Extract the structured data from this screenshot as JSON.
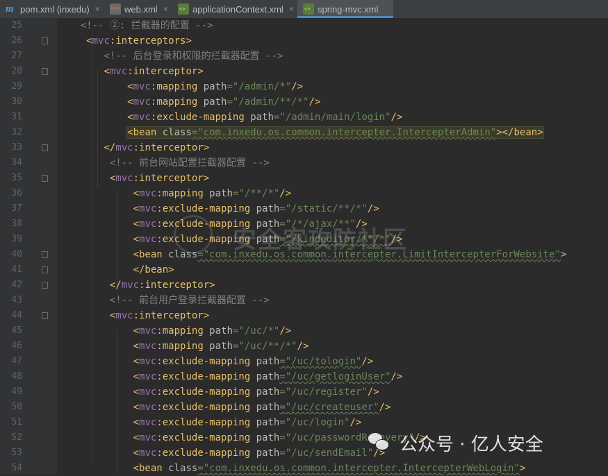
{
  "tabs": [
    {
      "label": "pom.xml (inxedu)",
      "icon": "maven-icon",
      "close": "×",
      "active": false
    },
    {
      "label": "web.xml",
      "icon": "xml-file-icon",
      "close": "×",
      "active": false
    },
    {
      "label": "applicationContext.xml",
      "icon": "spring-xml-icon",
      "close": "×",
      "active": false
    },
    {
      "label": "spring-mvc.xml",
      "icon": "spring-xml-icon",
      "close": "×",
      "active": true
    }
  ],
  "lines": [
    {
      "n": "25",
      "indent": "    ",
      "fold": false,
      "tokens": [
        {
          "k": "c",
          "t": "<!-- ②: 拦截器的配置 -->"
        }
      ]
    },
    {
      "n": "26",
      "indent": "     ",
      "fold": true,
      "tokens": [
        {
          "k": "t",
          "t": "<"
        },
        {
          "k": "ns",
          "t": "mvc"
        },
        {
          "k": "t",
          "t": ":interceptors>"
        }
      ]
    },
    {
      "n": "27",
      "indent": "        ",
      "fold": false,
      "tokens": [
        {
          "k": "c",
          "t": "<!-- 后台登录和权限的拦截器配置 -->"
        }
      ]
    },
    {
      "n": "28",
      "indent": "        ",
      "fold": true,
      "tokens": [
        {
          "k": "t",
          "t": "<"
        },
        {
          "k": "ns",
          "t": "mvc"
        },
        {
          "k": "t",
          "t": ":interceptor>"
        }
      ]
    },
    {
      "n": "29",
      "indent": "            ",
      "fold": false,
      "tokens": [
        {
          "k": "t",
          "t": "<"
        },
        {
          "k": "ns",
          "t": "mvc"
        },
        {
          "k": "t",
          "t": ":mapping "
        },
        {
          "k": "a",
          "t": "path"
        },
        {
          "k": "v",
          "t": "=\"/admin/*\""
        },
        {
          "k": "t",
          "t": "/>"
        }
      ]
    },
    {
      "n": "30",
      "indent": "            ",
      "fold": false,
      "tokens": [
        {
          "k": "t",
          "t": "<"
        },
        {
          "k": "ns",
          "t": "mvc"
        },
        {
          "k": "t",
          "t": ":mapping "
        },
        {
          "k": "a",
          "t": "path"
        },
        {
          "k": "v",
          "t": "=\"/admin/**/*\""
        },
        {
          "k": "t",
          "t": "/>"
        }
      ]
    },
    {
      "n": "31",
      "indent": "            ",
      "fold": false,
      "tokens": [
        {
          "k": "t",
          "t": "<"
        },
        {
          "k": "ns",
          "t": "mvc"
        },
        {
          "k": "t",
          "t": ":exclude-mapping "
        },
        {
          "k": "a",
          "t": "path"
        },
        {
          "k": "v",
          "t": "=\"/admin/main/login\""
        },
        {
          "k": "t",
          "t": "/>"
        }
      ]
    },
    {
      "n": "32",
      "indent": "            ",
      "fold": false,
      "hl": true,
      "tokens": [
        {
          "k": "t",
          "t": "<bean "
        },
        {
          "k": "a",
          "t": "class"
        },
        {
          "k": "v",
          "t": "=\"com.inxedu.os.common.intercepter.IntercepterAdmin\""
        },
        {
          "k": "t",
          "t": "></bean>"
        }
      ]
    },
    {
      "n": "33",
      "indent": "        ",
      "fold": true,
      "tokens": [
        {
          "k": "t",
          "t": "</"
        },
        {
          "k": "ns",
          "t": "mvc"
        },
        {
          "k": "t",
          "t": ":interceptor>"
        }
      ]
    },
    {
      "n": "34",
      "indent": "         ",
      "fold": false,
      "tokens": [
        {
          "k": "c",
          "t": "<!-- 前台网站配置拦截器配置 -->"
        }
      ]
    },
    {
      "n": "35",
      "indent": "         ",
      "fold": true,
      "tokens": [
        {
          "k": "t",
          "t": "<"
        },
        {
          "k": "ns",
          "t": "mvc"
        },
        {
          "k": "t",
          "t": ":interceptor>"
        }
      ]
    },
    {
      "n": "36",
      "indent": "             ",
      "fold": false,
      "tokens": [
        {
          "k": "t",
          "t": "<"
        },
        {
          "k": "ns",
          "t": "mvc"
        },
        {
          "k": "t",
          "t": ":mapping "
        },
        {
          "k": "a",
          "t": "path"
        },
        {
          "k": "v",
          "t": "=\"/**/*\""
        },
        {
          "k": "t",
          "t": "/>"
        }
      ]
    },
    {
      "n": "37",
      "indent": "             ",
      "fold": false,
      "tokens": [
        {
          "k": "t",
          "t": "<"
        },
        {
          "k": "ns",
          "t": "mvc"
        },
        {
          "k": "t",
          "t": ":exclude-mapping "
        },
        {
          "k": "a",
          "t": "path"
        },
        {
          "k": "v",
          "t": "=\"/static/**/*\""
        },
        {
          "k": "t",
          "t": "/>"
        }
      ]
    },
    {
      "n": "38",
      "indent": "             ",
      "fold": false,
      "tokens": [
        {
          "k": "t",
          "t": "<"
        },
        {
          "k": "ns",
          "t": "mvc"
        },
        {
          "k": "t",
          "t": ":exclude-mapping "
        },
        {
          "k": "a",
          "t": "path"
        },
        {
          "k": "v",
          "t": "=\"/*/ajax/**\""
        },
        {
          "k": "t",
          "t": "/>"
        }
      ]
    },
    {
      "n": "39",
      "indent": "             ",
      "fold": false,
      "tokens": [
        {
          "k": "t",
          "t": "<"
        },
        {
          "k": "ns",
          "t": "mvc"
        },
        {
          "k": "t",
          "t": ":exclude-mapping "
        },
        {
          "k": "a",
          "t": "path"
        },
        {
          "k": "v",
          "t": "=\"/kindeditor/**/*\""
        },
        {
          "k": "t",
          "t": "/>"
        }
      ]
    },
    {
      "n": "40",
      "indent": "             ",
      "fold": true,
      "tokens": [
        {
          "k": "t",
          "t": "<bean "
        },
        {
          "k": "a",
          "t": "class"
        },
        {
          "k": "v",
          "t": "=\"com.inxedu.os.common.intercepter.LimitIntercepterForWebsite\""
        },
        {
          "k": "t",
          "t": ">"
        }
      ]
    },
    {
      "n": "41",
      "indent": "             ",
      "fold": true,
      "tokens": [
        {
          "k": "t",
          "t": "</bean>"
        }
      ]
    },
    {
      "n": "42",
      "indent": "         ",
      "fold": true,
      "tokens": [
        {
          "k": "t",
          "t": "</"
        },
        {
          "k": "ns",
          "t": "mvc"
        },
        {
          "k": "t",
          "t": ":interceptor>"
        }
      ]
    },
    {
      "n": "43",
      "indent": "         ",
      "fold": false,
      "tokens": [
        {
          "k": "c",
          "t": "<!-- 前台用户登录拦截器配置 -->"
        }
      ]
    },
    {
      "n": "44",
      "indent": "         ",
      "fold": true,
      "tokens": [
        {
          "k": "t",
          "t": "<"
        },
        {
          "k": "ns",
          "t": "mvc"
        },
        {
          "k": "t",
          "t": ":interceptor>"
        }
      ]
    },
    {
      "n": "45",
      "indent": "             ",
      "fold": false,
      "tokens": [
        {
          "k": "t",
          "t": "<"
        },
        {
          "k": "ns",
          "t": "mvc"
        },
        {
          "k": "t",
          "t": ":mapping "
        },
        {
          "k": "a",
          "t": "path"
        },
        {
          "k": "v",
          "t": "=\"/uc/*\""
        },
        {
          "k": "t",
          "t": "/>"
        }
      ]
    },
    {
      "n": "46",
      "indent": "             ",
      "fold": false,
      "tokens": [
        {
          "k": "t",
          "t": "<"
        },
        {
          "k": "ns",
          "t": "mvc"
        },
        {
          "k": "t",
          "t": ":mapping "
        },
        {
          "k": "a",
          "t": "path"
        },
        {
          "k": "v",
          "t": "=\"/uc/**/*\""
        },
        {
          "k": "t",
          "t": "/>"
        }
      ]
    },
    {
      "n": "47",
      "indent": "             ",
      "fold": false,
      "tokens": [
        {
          "k": "t",
          "t": "<"
        },
        {
          "k": "ns",
          "t": "mvc"
        },
        {
          "k": "t",
          "t": ":exclude-mapping "
        },
        {
          "k": "a",
          "t": "path"
        },
        {
          "k": "v",
          "t": "=\"/uc/tologin\""
        },
        {
          "k": "t",
          "t": "/>"
        }
      ]
    },
    {
      "n": "48",
      "indent": "             ",
      "fold": false,
      "tokens": [
        {
          "k": "t",
          "t": "<"
        },
        {
          "k": "ns",
          "t": "mvc"
        },
        {
          "k": "t",
          "t": ":exclude-mapping "
        },
        {
          "k": "a",
          "t": "path"
        },
        {
          "k": "v",
          "t": "=\"/uc/getloginUser\""
        },
        {
          "k": "t",
          "t": "/>"
        }
      ]
    },
    {
      "n": "49",
      "indent": "             ",
      "fold": false,
      "tokens": [
        {
          "k": "t",
          "t": "<"
        },
        {
          "k": "ns",
          "t": "mvc"
        },
        {
          "k": "t",
          "t": ":exclude-mapping "
        },
        {
          "k": "a",
          "t": "path"
        },
        {
          "k": "v",
          "t": "=\"/uc/register\""
        },
        {
          "k": "t",
          "t": "/>"
        }
      ]
    },
    {
      "n": "50",
      "indent": "             ",
      "fold": false,
      "tokens": [
        {
          "k": "t",
          "t": "<"
        },
        {
          "k": "ns",
          "t": "mvc"
        },
        {
          "k": "t",
          "t": ":exclude-mapping "
        },
        {
          "k": "a",
          "t": "path"
        },
        {
          "k": "v",
          "t": "=\"/uc/createuser\""
        },
        {
          "k": "t",
          "t": "/>"
        }
      ]
    },
    {
      "n": "51",
      "indent": "             ",
      "fold": false,
      "tokens": [
        {
          "k": "t",
          "t": "<"
        },
        {
          "k": "ns",
          "t": "mvc"
        },
        {
          "k": "t",
          "t": ":exclude-mapping "
        },
        {
          "k": "a",
          "t": "path"
        },
        {
          "k": "v",
          "t": "=\"/uc/login\""
        },
        {
          "k": "t",
          "t": "/>"
        }
      ]
    },
    {
      "n": "52",
      "indent": "             ",
      "fold": false,
      "tokens": [
        {
          "k": "t",
          "t": "<"
        },
        {
          "k": "ns",
          "t": "mvc"
        },
        {
          "k": "t",
          "t": ":exclude-mapping "
        },
        {
          "k": "a",
          "t": "path"
        },
        {
          "k": "v",
          "t": "=\"/uc/passwordRecovery\""
        },
        {
          "k": "t",
          "t": "/>"
        }
      ]
    },
    {
      "n": "53",
      "indent": "             ",
      "fold": false,
      "tokens": [
        {
          "k": "t",
          "t": "<"
        },
        {
          "k": "ns",
          "t": "mvc"
        },
        {
          "k": "t",
          "t": ":exclude-mapping "
        },
        {
          "k": "a",
          "t": "path"
        },
        {
          "k": "v",
          "t": "=\"/uc/sendEmail\""
        },
        {
          "k": "t",
          "t": "/>"
        }
      ]
    },
    {
      "n": "54",
      "indent": "             ",
      "fold": false,
      "tokens": [
        {
          "k": "t",
          "t": "<bean "
        },
        {
          "k": "a",
          "t": "class"
        },
        {
          "k": "v",
          "t": "=\"com.inxedu.os.common.intercepter.IntercepterWebLogin\""
        },
        {
          "k": "t",
          "t": ">"
        }
      ]
    }
  ],
  "watermark": {
    "text": "安全客攻防社区",
    "bottom_text": "公众号 · 亿人安全"
  },
  "colors": {
    "background": "#2b2b2b",
    "tag": "#e8bf6a",
    "namespace": "#9876aa",
    "attribute": "#bababa",
    "value": "#6a8759",
    "comment": "#808080",
    "active_tab_underline": "#4a88c7"
  }
}
